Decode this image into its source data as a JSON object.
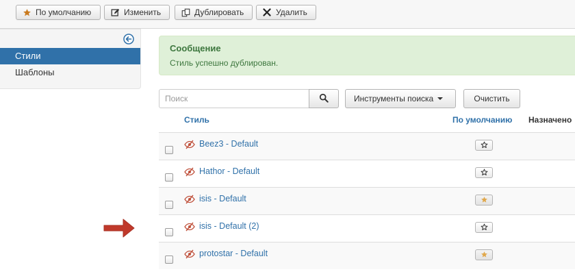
{
  "toolbar": {
    "buttons": [
      {
        "label": "По умолчанию",
        "icon": "star-icon"
      },
      {
        "label": "Изменить",
        "icon": "edit-icon"
      },
      {
        "label": "Дублировать",
        "icon": "copy-icon"
      },
      {
        "label": "Удалить",
        "icon": "close-icon"
      }
    ]
  },
  "sidebar": {
    "collapse_icon": "arrow-left-circle-icon",
    "items": [
      {
        "label": "Стили",
        "active": true
      },
      {
        "label": "Шаблоны",
        "active": false
      }
    ]
  },
  "message": {
    "heading": "Сообщение",
    "text": "Стиль успешно дублирован."
  },
  "search": {
    "placeholder": "Поиск",
    "value": "",
    "search_icon": "search-icon",
    "tools_label": "Инструменты поиска",
    "clear_label": "Очистить"
  },
  "table": {
    "headers": {
      "style": "Стиль",
      "default": "По умолчанию",
      "assigned": "Назначено"
    },
    "rows": [
      {
        "name": "Beez3 - Default",
        "is_default": false
      },
      {
        "name": "Hathor - Default",
        "is_default": false
      },
      {
        "name": "isis - Default",
        "is_default": true
      },
      {
        "name": "isis - Default (2)",
        "is_default": false
      },
      {
        "name": "protostar - Default",
        "is_default": true
      }
    ]
  },
  "colors": {
    "accent": "#3071a9",
    "success_bg": "#dff0d8",
    "success_text": "#3c763d",
    "star_active": "#e0a84c",
    "annotation_arrow": "#c0392b"
  }
}
